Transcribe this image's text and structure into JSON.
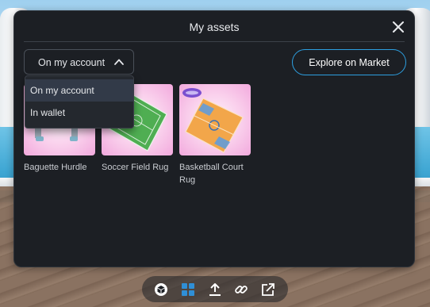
{
  "modal": {
    "title": "My assets"
  },
  "filter": {
    "selected": "On my account",
    "options": [
      "On my account",
      "In wallet"
    ]
  },
  "market_button": "Explore on Market",
  "assets": [
    {
      "name": "Baguette Hurdle"
    },
    {
      "name": "Soccer Field Rug"
    },
    {
      "name": "Basketball Court Rug"
    }
  ],
  "toolbar": {
    "items": [
      "cube-icon",
      "grid-icon",
      "upload-icon",
      "link-icon",
      "external-link-icon"
    ],
    "active": "grid-icon"
  },
  "colors": {
    "panel": "#1c1f24",
    "accent": "#2d9fe0",
    "thumb_bg": "#f9cdeb",
    "active_icon": "#2f8fd6"
  }
}
